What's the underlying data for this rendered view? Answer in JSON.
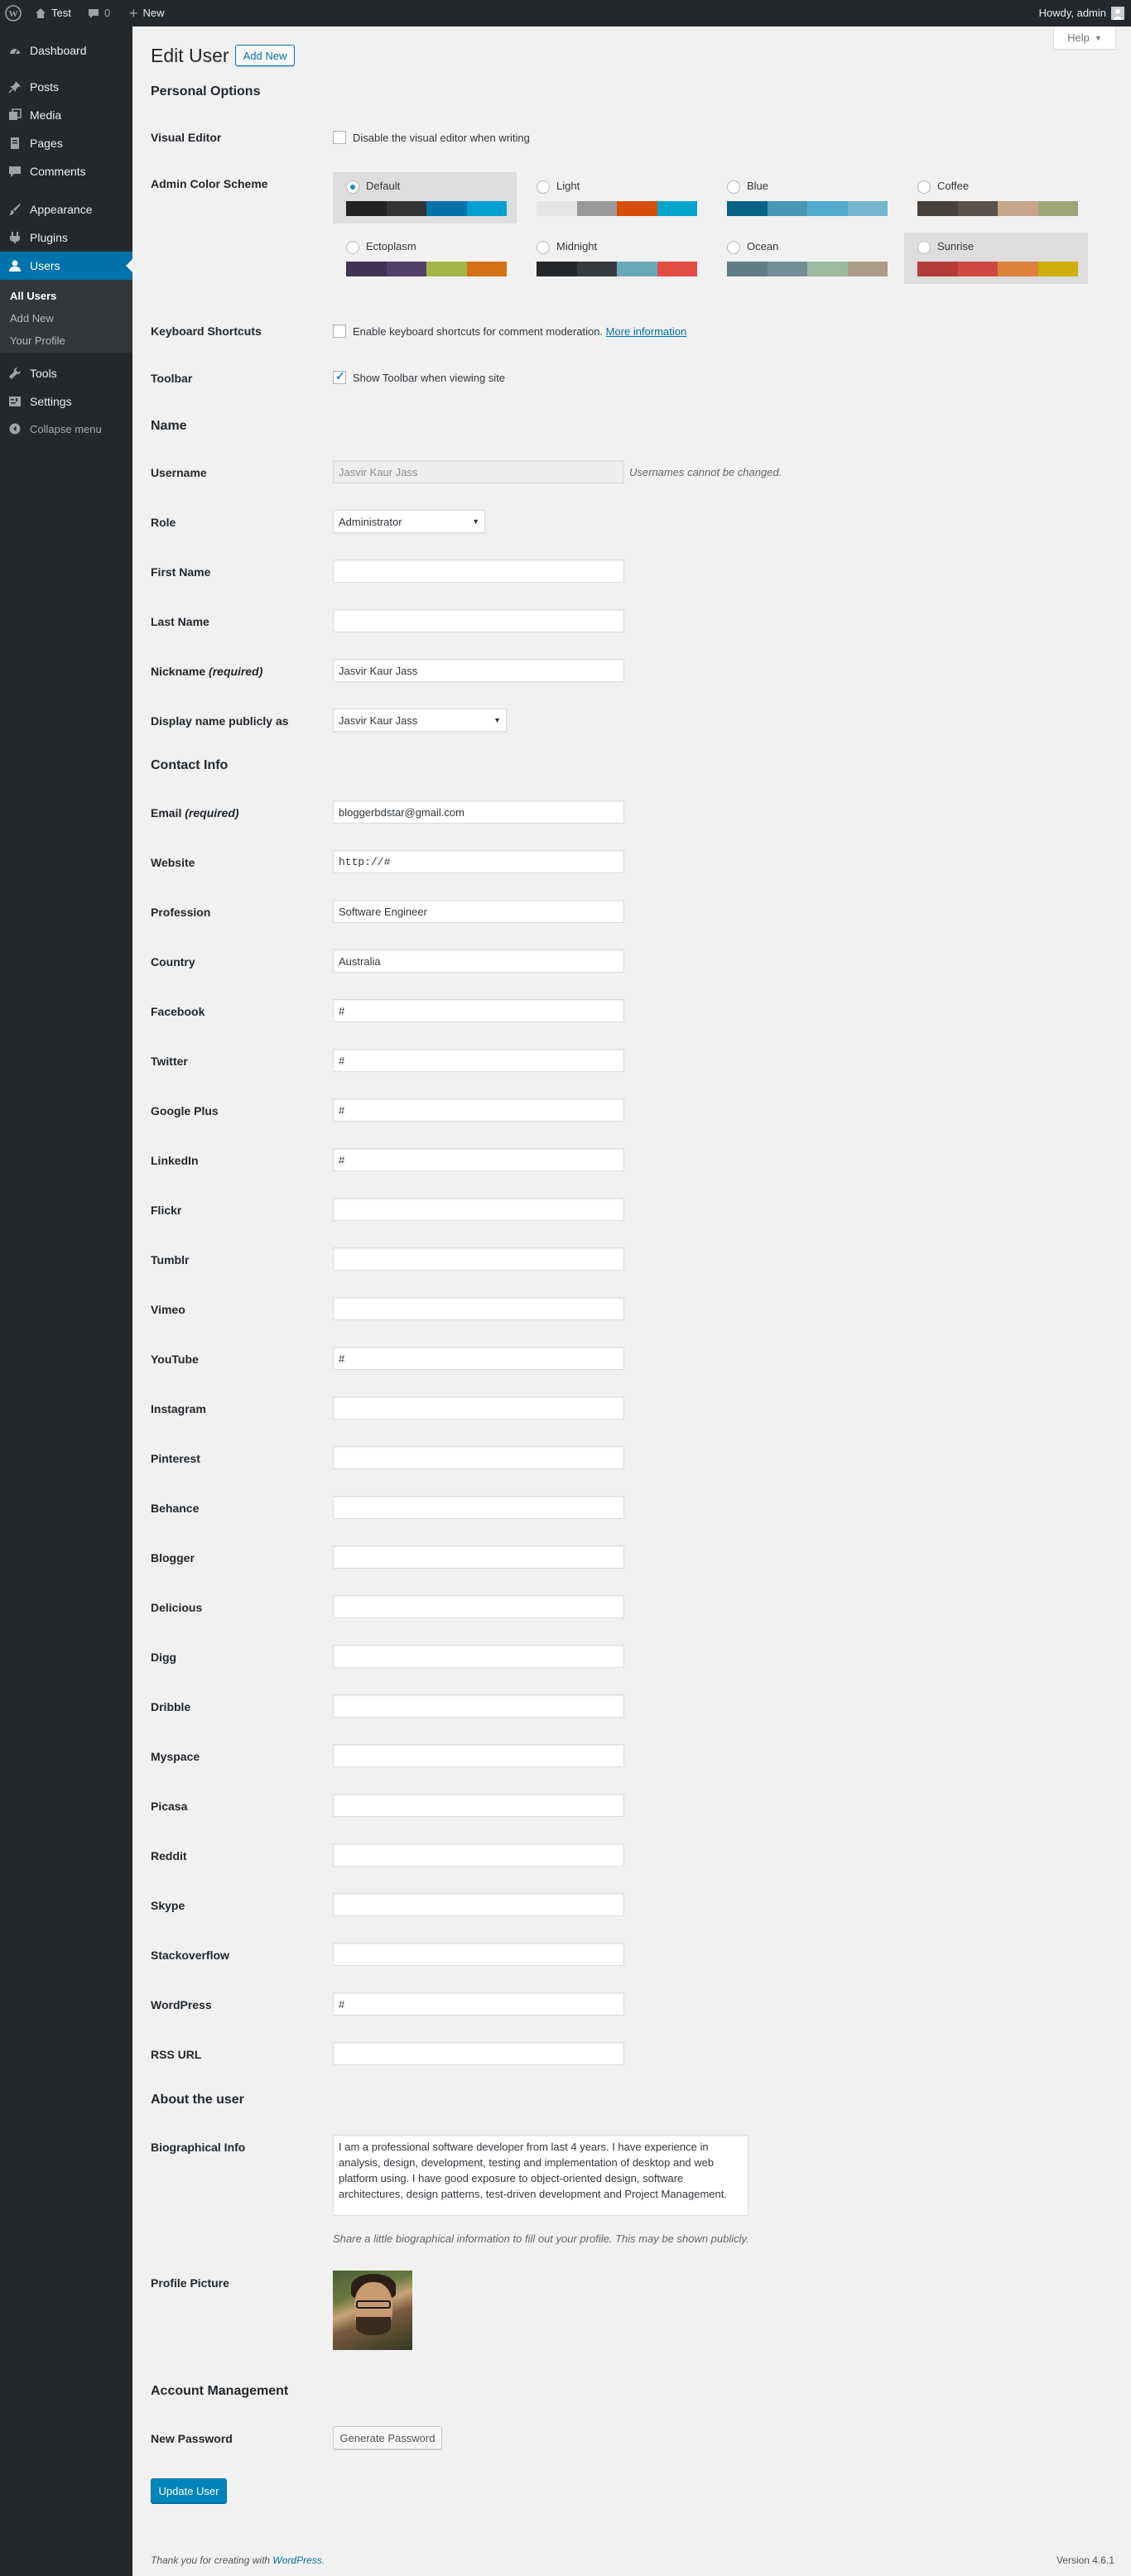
{
  "adminbar": {
    "site_name": "Test",
    "comments_count": "0",
    "new_label": "New",
    "greeting": "Howdy, admin"
  },
  "sidebar": {
    "items": [
      {
        "label": "Dashboard",
        "icon": "dashboard-icon"
      },
      {
        "label": "Posts",
        "icon": "pin-icon"
      },
      {
        "label": "Media",
        "icon": "media-icon"
      },
      {
        "label": "Pages",
        "icon": "page-icon"
      },
      {
        "label": "Comments",
        "icon": "comment-icon"
      },
      {
        "label": "Appearance",
        "icon": "brush-icon"
      },
      {
        "label": "Plugins",
        "icon": "plugin-icon"
      },
      {
        "label": "Users",
        "icon": "user-icon"
      },
      {
        "label": "Tools",
        "icon": "wrench-icon"
      },
      {
        "label": "Settings",
        "icon": "settings-icon"
      }
    ],
    "submenu": [
      "All Users",
      "Add New",
      "Your Profile"
    ],
    "collapse_label": "Collapse menu"
  },
  "header": {
    "title": "Edit User",
    "add_new": "Add New",
    "help": "Help"
  },
  "personal": {
    "heading": "Personal Options",
    "visual_editor_label": "Visual Editor",
    "visual_editor_text": "Disable the visual editor when writing",
    "color_scheme_label": "Admin Color Scheme",
    "schemes": [
      {
        "name": "Default",
        "colors": [
          "#222222",
          "#333333",
          "#0073aa",
          "#00a0d2"
        ]
      },
      {
        "name": "Light",
        "colors": [
          "#e5e5e5",
          "#999999",
          "#d64e07",
          "#04a4cc"
        ]
      },
      {
        "name": "Blue",
        "colors": [
          "#096484",
          "#4796b3",
          "#52accc",
          "#74b6ce"
        ]
      },
      {
        "name": "Coffee",
        "colors": [
          "#46403c",
          "#59524c",
          "#c7a589",
          "#9ea476"
        ]
      },
      {
        "name": "Ectoplasm",
        "colors": [
          "#413256",
          "#523f6d",
          "#a3b745",
          "#d46f15"
        ]
      },
      {
        "name": "Midnight",
        "colors": [
          "#25282b",
          "#363b3f",
          "#69a8bb",
          "#e14d43"
        ]
      },
      {
        "name": "Ocean",
        "colors": [
          "#627c83",
          "#738e96",
          "#9ebaa0",
          "#aa9d88"
        ]
      },
      {
        "name": "Sunrise",
        "colors": [
          "#b43c38",
          "#cf4944",
          "#dd823b",
          "#ccaf0b"
        ]
      }
    ],
    "keyboard_label": "Keyboard Shortcuts",
    "keyboard_text": "Enable keyboard shortcuts for comment moderation.",
    "keyboard_link": "More information",
    "toolbar_label": "Toolbar",
    "toolbar_text": "Show Toolbar when viewing site"
  },
  "name": {
    "heading": "Name",
    "username_label": "Username",
    "username_value": "Jasvir Kaur Jass",
    "username_note": "Usernames cannot be changed.",
    "role_label": "Role",
    "role_value": "Administrator",
    "first_name_label": "First Name",
    "last_name_label": "Last Name",
    "nickname_label": "Nickname",
    "nickname_required": "(required)",
    "nickname_value": "Jasvir Kaur Jass",
    "display_label": "Display name publicly as",
    "display_value": "Jasvir Kaur Jass"
  },
  "contact": {
    "heading": "Contact Info",
    "email_label": "Email",
    "email_required": "(required)",
    "email_value": "bloggerbdstar@gmail.com",
    "website_label": "Website",
    "website_value": "http://#",
    "fields": [
      {
        "label": "Profession",
        "value": "Software Engineer"
      },
      {
        "label": "Country",
        "value": "Australia"
      },
      {
        "label": "Facebook",
        "value": "#"
      },
      {
        "label": "Twitter",
        "value": "#"
      },
      {
        "label": "Google Plus",
        "value": "#"
      },
      {
        "label": "LinkedIn",
        "value": "#"
      },
      {
        "label": "Flickr",
        "value": ""
      },
      {
        "label": "Tumblr",
        "value": ""
      },
      {
        "label": "Vimeo",
        "value": ""
      },
      {
        "label": "YouTube",
        "value": "#"
      },
      {
        "label": "Instagram",
        "value": ""
      },
      {
        "label": "Pinterest",
        "value": ""
      },
      {
        "label": "Behance",
        "value": ""
      },
      {
        "label": "Blogger",
        "value": ""
      },
      {
        "label": "Delicious",
        "value": ""
      },
      {
        "label": "Digg",
        "value": ""
      },
      {
        "label": "Dribble",
        "value": ""
      },
      {
        "label": "Myspace",
        "value": ""
      },
      {
        "label": "Picasa",
        "value": ""
      },
      {
        "label": "Reddit",
        "value": ""
      },
      {
        "label": "Skype",
        "value": ""
      },
      {
        "label": "Stackoverflow",
        "value": ""
      },
      {
        "label": "WordPress",
        "value": "#"
      },
      {
        "label": "RSS URL",
        "value": ""
      }
    ]
  },
  "about": {
    "heading": "About the user",
    "bio_label": "Biographical Info",
    "bio_value": "I am a professional software developer from last 4 years. I have experience in analysis, design, development, testing and implementation of desktop and web platform using. I have good exposure to object-oriented design, software architectures, design patterns, test-driven development and Project Management.",
    "bio_note": "Share a little biographical information to fill out your profile. This may be shown publicly.",
    "picture_label": "Profile Picture"
  },
  "account": {
    "heading": "Account Management",
    "password_label": "New Password",
    "generate_button": "Generate Password",
    "update_button": "Update User"
  },
  "footer": {
    "thanks_prefix": "Thank you for creating with",
    "thanks_link": "WordPress",
    "version": "Version 4.6.1"
  }
}
